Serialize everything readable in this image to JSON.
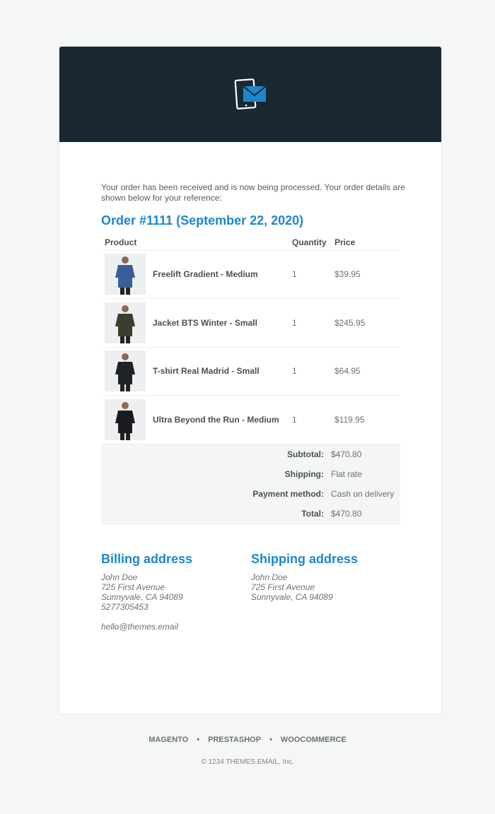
{
  "intro": "Your order has been received and is now being processed. Your order details are shown below for your reference:",
  "order_title": "Order #1111 (September 22, 2020)",
  "table": {
    "headers": [
      "Product",
      "Quantity",
      "Price"
    ],
    "rows": [
      {
        "name": "Freelift Gradient - Medium",
        "qty": "1",
        "price": "$39.95",
        "color": "#3a5f96"
      },
      {
        "name": "Jacket BTS Winter - Small",
        "qty": "1",
        "price": "$245.95",
        "color": "#3b3e2c"
      },
      {
        "name": "T-shirt Real Madrid - Small",
        "qty": "1",
        "price": "$64.95",
        "color": "#1e2226"
      },
      {
        "name": "Ultra Beyond the Run - Medium",
        "qty": "1",
        "price": "$119.95",
        "color": "#1a1b1e"
      }
    ]
  },
  "summary": [
    {
      "label": "Subtotal:",
      "value": "$470.80"
    },
    {
      "label": "Shipping:",
      "value": "Flat rate"
    },
    {
      "label": "Payment method:",
      "value": "Cash on delivery"
    },
    {
      "label": "Total:",
      "value": "$470.80"
    }
  ],
  "billing": {
    "title": "Billing address",
    "lines": [
      "John Doe",
      "725 First Avenue",
      "Sunnyvale, CA 94089",
      "5277305453"
    ],
    "email": "hello@themes.email"
  },
  "shipping": {
    "title": "Shipping address",
    "lines": [
      "John Doe",
      "725 First Avenue",
      "Sunnyvale, CA 94089"
    ]
  },
  "footer": {
    "links": [
      "MAGENTO",
      "PRESTASHOP",
      "WOOCOMMERCE"
    ],
    "separator": "•",
    "copyright": "© 1234 THEMES.EMAIL, Inc."
  },
  "colors": {
    "accent": "#1d87cc",
    "header_bg": "#1b2731"
  }
}
